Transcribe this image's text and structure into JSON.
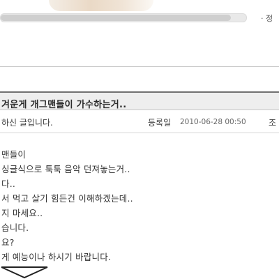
{
  "header": {
    "corner_link": "· 정"
  },
  "post": {
    "title": "겨운게 개그맨들이 가수하는거..",
    "author_text": "하신 글입니다.",
    "date_label": "등록일",
    "date": "2010-06-28 00:50",
    "views_label": "조"
  },
  "body_lines": [
    "맨들이",
    "싱글식으로 툭툭 음악 던져놓는거..",
    "다..",
    "서 먹고 살기 힘든건 이해하겠는데..",
    "지 마세요..",
    "습니다.",
    "요?",
    "게 예능이나 하시기 바랍니다."
  ],
  "icons": {
    "mail": "envelope-icon"
  }
}
